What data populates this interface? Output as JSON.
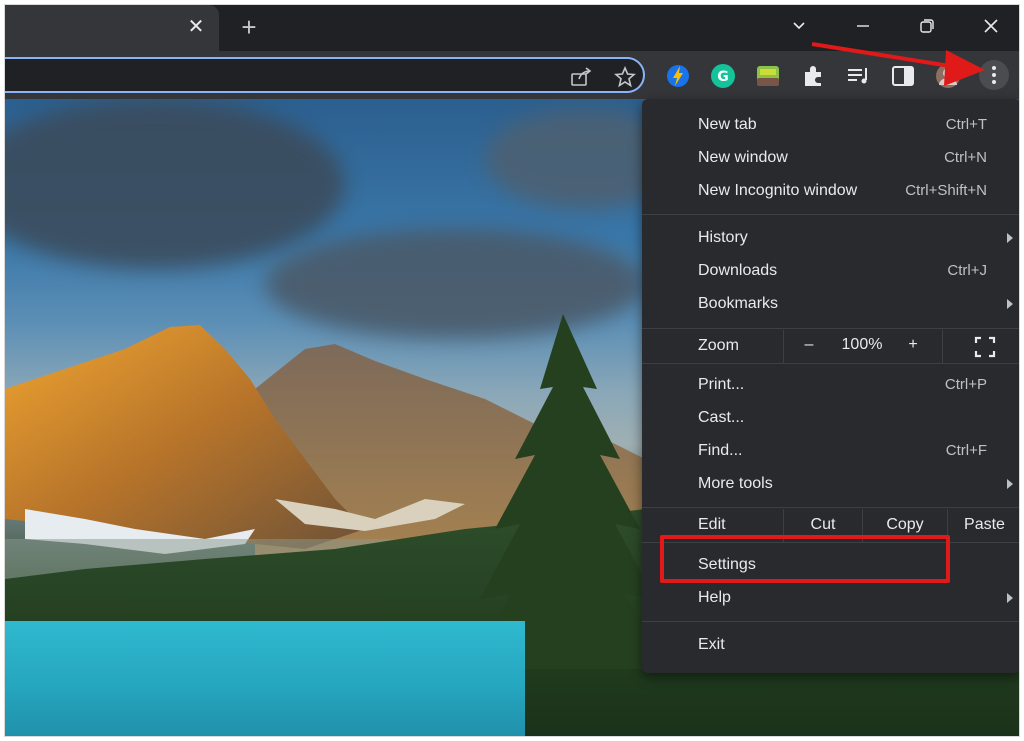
{
  "tabs": {
    "close_glyph": "✕",
    "new_tab_glyph": "+"
  },
  "window_controls": {
    "tab_search": "⌄",
    "minimize": "—",
    "restore": "❐",
    "close": "✕"
  },
  "icons": [
    "share-icon",
    "bookmark-star-icon",
    "extension-lightning-icon",
    "grammarly-icon",
    "extension-green-icon",
    "puzzle-extensions-icon",
    "reading-list-icon",
    "side-panel-icon",
    "profile-icon",
    "kebab-menu-icon"
  ],
  "menu": {
    "new_tab": {
      "label": "New tab",
      "shortcut": "Ctrl+T"
    },
    "new_window": {
      "label": "New window",
      "shortcut": "Ctrl+N"
    },
    "new_incognito": {
      "label": "New Incognito window",
      "shortcut": "Ctrl+Shift+N"
    },
    "history": {
      "label": "History"
    },
    "downloads": {
      "label": "Downloads",
      "shortcut": "Ctrl+J"
    },
    "bookmarks": {
      "label": "Bookmarks"
    },
    "zoom": {
      "label": "Zoom",
      "minus": "–",
      "value": "100%",
      "plus": "+"
    },
    "print": {
      "label": "Print...",
      "shortcut": "Ctrl+P"
    },
    "cast": {
      "label": "Cast..."
    },
    "find": {
      "label": "Find...",
      "shortcut": "Ctrl+F"
    },
    "more_tools": {
      "label": "More tools"
    },
    "edit": {
      "label": "Edit",
      "cut": "Cut",
      "copy": "Copy",
      "paste": "Paste"
    },
    "settings": {
      "label": "Settings"
    },
    "help": {
      "label": "Help"
    },
    "exit": {
      "label": "Exit"
    }
  },
  "colors": {
    "accent": "#8ab4f8",
    "annotation": "#e01919",
    "menu_bg": "#292a2d",
    "toolbar_bg": "#35363a"
  }
}
